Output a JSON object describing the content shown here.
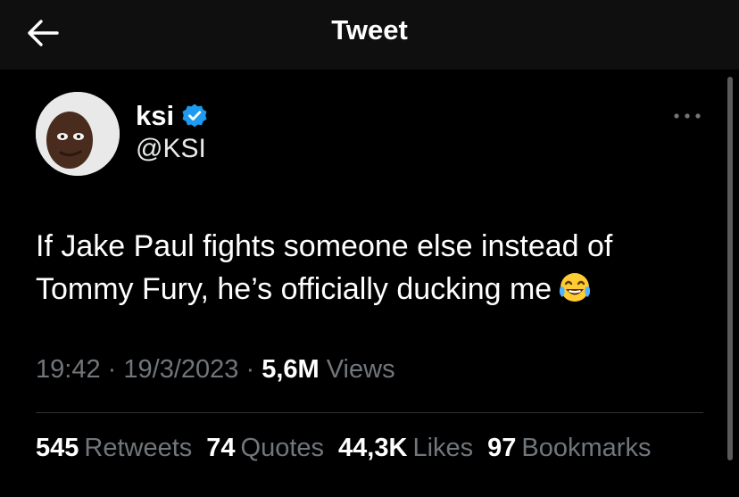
{
  "header": {
    "title": "Tweet",
    "back_icon": "arrow-left-icon"
  },
  "author": {
    "display_name": "ksi",
    "handle": "@KSI",
    "verified_icon": "verified-badge-icon",
    "verified_color": "#1d9bf0"
  },
  "tweet": {
    "text": "If Jake Paul fights someone else instead of Tommy Fury, he’s officially ducking me",
    "emoji": "face-with-tears-of-joy"
  },
  "meta": {
    "time": "19:42",
    "separator": "·",
    "date": "19/3/2023",
    "views_count": "5,6M",
    "views_label": "Views"
  },
  "stats": {
    "retweets_count": "545",
    "retweets_label": "Retweets",
    "quotes_count": "74",
    "quotes_label": "Quotes",
    "likes_count": "44,3K",
    "likes_label": "Likes",
    "bookmarks_count": "97",
    "bookmarks_label": "Bookmarks"
  },
  "more_icon": "more-horizontal-icon"
}
